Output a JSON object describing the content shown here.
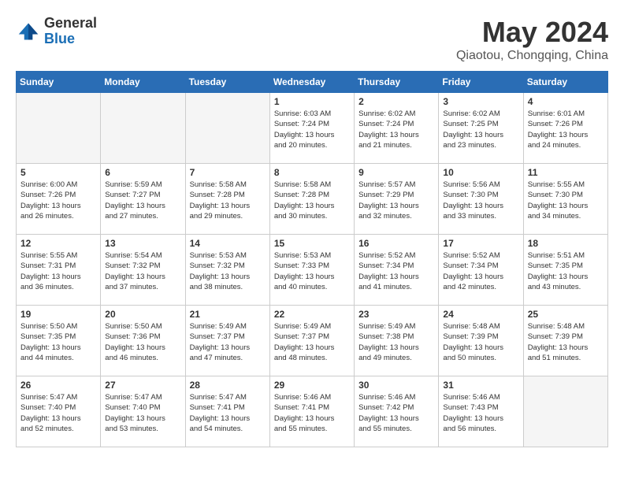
{
  "logo": {
    "line1": "General",
    "line2": "Blue"
  },
  "title": "May 2024",
  "location": "Qiaotou, Chongqing, China",
  "days_of_week": [
    "Sunday",
    "Monday",
    "Tuesday",
    "Wednesday",
    "Thursday",
    "Friday",
    "Saturday"
  ],
  "weeks": [
    [
      {
        "day": "",
        "info": ""
      },
      {
        "day": "",
        "info": ""
      },
      {
        "day": "",
        "info": ""
      },
      {
        "day": "1",
        "info": "Sunrise: 6:03 AM\nSunset: 7:24 PM\nDaylight: 13 hours\nand 20 minutes."
      },
      {
        "day": "2",
        "info": "Sunrise: 6:02 AM\nSunset: 7:24 PM\nDaylight: 13 hours\nand 21 minutes."
      },
      {
        "day": "3",
        "info": "Sunrise: 6:02 AM\nSunset: 7:25 PM\nDaylight: 13 hours\nand 23 minutes."
      },
      {
        "day": "4",
        "info": "Sunrise: 6:01 AM\nSunset: 7:26 PM\nDaylight: 13 hours\nand 24 minutes."
      }
    ],
    [
      {
        "day": "5",
        "info": "Sunrise: 6:00 AM\nSunset: 7:26 PM\nDaylight: 13 hours\nand 26 minutes."
      },
      {
        "day": "6",
        "info": "Sunrise: 5:59 AM\nSunset: 7:27 PM\nDaylight: 13 hours\nand 27 minutes."
      },
      {
        "day": "7",
        "info": "Sunrise: 5:58 AM\nSunset: 7:28 PM\nDaylight: 13 hours\nand 29 minutes."
      },
      {
        "day": "8",
        "info": "Sunrise: 5:58 AM\nSunset: 7:28 PM\nDaylight: 13 hours\nand 30 minutes."
      },
      {
        "day": "9",
        "info": "Sunrise: 5:57 AM\nSunset: 7:29 PM\nDaylight: 13 hours\nand 32 minutes."
      },
      {
        "day": "10",
        "info": "Sunrise: 5:56 AM\nSunset: 7:30 PM\nDaylight: 13 hours\nand 33 minutes."
      },
      {
        "day": "11",
        "info": "Sunrise: 5:55 AM\nSunset: 7:30 PM\nDaylight: 13 hours\nand 34 minutes."
      }
    ],
    [
      {
        "day": "12",
        "info": "Sunrise: 5:55 AM\nSunset: 7:31 PM\nDaylight: 13 hours\nand 36 minutes."
      },
      {
        "day": "13",
        "info": "Sunrise: 5:54 AM\nSunset: 7:32 PM\nDaylight: 13 hours\nand 37 minutes."
      },
      {
        "day": "14",
        "info": "Sunrise: 5:53 AM\nSunset: 7:32 PM\nDaylight: 13 hours\nand 38 minutes."
      },
      {
        "day": "15",
        "info": "Sunrise: 5:53 AM\nSunset: 7:33 PM\nDaylight: 13 hours\nand 40 minutes."
      },
      {
        "day": "16",
        "info": "Sunrise: 5:52 AM\nSunset: 7:34 PM\nDaylight: 13 hours\nand 41 minutes."
      },
      {
        "day": "17",
        "info": "Sunrise: 5:52 AM\nSunset: 7:34 PM\nDaylight: 13 hours\nand 42 minutes."
      },
      {
        "day": "18",
        "info": "Sunrise: 5:51 AM\nSunset: 7:35 PM\nDaylight: 13 hours\nand 43 minutes."
      }
    ],
    [
      {
        "day": "19",
        "info": "Sunrise: 5:50 AM\nSunset: 7:35 PM\nDaylight: 13 hours\nand 44 minutes."
      },
      {
        "day": "20",
        "info": "Sunrise: 5:50 AM\nSunset: 7:36 PM\nDaylight: 13 hours\nand 46 minutes."
      },
      {
        "day": "21",
        "info": "Sunrise: 5:49 AM\nSunset: 7:37 PM\nDaylight: 13 hours\nand 47 minutes."
      },
      {
        "day": "22",
        "info": "Sunrise: 5:49 AM\nSunset: 7:37 PM\nDaylight: 13 hours\nand 48 minutes."
      },
      {
        "day": "23",
        "info": "Sunrise: 5:49 AM\nSunset: 7:38 PM\nDaylight: 13 hours\nand 49 minutes."
      },
      {
        "day": "24",
        "info": "Sunrise: 5:48 AM\nSunset: 7:39 PM\nDaylight: 13 hours\nand 50 minutes."
      },
      {
        "day": "25",
        "info": "Sunrise: 5:48 AM\nSunset: 7:39 PM\nDaylight: 13 hours\nand 51 minutes."
      }
    ],
    [
      {
        "day": "26",
        "info": "Sunrise: 5:47 AM\nSunset: 7:40 PM\nDaylight: 13 hours\nand 52 minutes."
      },
      {
        "day": "27",
        "info": "Sunrise: 5:47 AM\nSunset: 7:40 PM\nDaylight: 13 hours\nand 53 minutes."
      },
      {
        "day": "28",
        "info": "Sunrise: 5:47 AM\nSunset: 7:41 PM\nDaylight: 13 hours\nand 54 minutes."
      },
      {
        "day": "29",
        "info": "Sunrise: 5:46 AM\nSunset: 7:41 PM\nDaylight: 13 hours\nand 55 minutes."
      },
      {
        "day": "30",
        "info": "Sunrise: 5:46 AM\nSunset: 7:42 PM\nDaylight: 13 hours\nand 55 minutes."
      },
      {
        "day": "31",
        "info": "Sunrise: 5:46 AM\nSunset: 7:43 PM\nDaylight: 13 hours\nand 56 minutes."
      },
      {
        "day": "",
        "info": ""
      }
    ]
  ]
}
